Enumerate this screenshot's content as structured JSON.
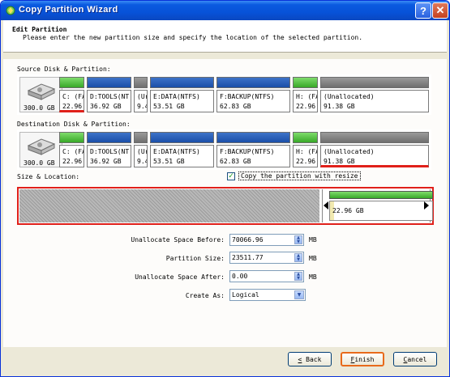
{
  "window": {
    "title": "Copy Partition Wizard",
    "help_label": "?",
    "close_label": "✕"
  },
  "header": {
    "title": "Edit Partition",
    "subtitle": "Please enter the new partition size and specify the location of the selected partition."
  },
  "source": {
    "label": "Source Disk & Partition:",
    "disk_size": "300.0 GB",
    "partitions": [
      {
        "line1": "C: (FA",
        "line2": "22.96",
        "color": "green"
      },
      {
        "line1": "D:TOOLS(NT",
        "line2": "36.92 GB",
        "color": "blue"
      },
      {
        "line1": "(Ur",
        "line2": "9.4",
        "color": "gray"
      },
      {
        "line1": "E:DATA(NTFS)",
        "line2": "53.51 GB",
        "color": "blue"
      },
      {
        "line1": "F:BACKUP(NTFS)",
        "line2": "62.83 GB",
        "color": "blue"
      },
      {
        "line1": "H: (FA",
        "line2": "22.96",
        "color": "green"
      },
      {
        "line1": "(Unallocated)",
        "line2": "91.38 GB",
        "color": "gray"
      }
    ]
  },
  "destination": {
    "label": "Destination Disk & Partition:",
    "disk_size": "300.0 GB",
    "partitions": [
      {
        "line1": "C: (FA",
        "line2": "22.96",
        "color": "green"
      },
      {
        "line1": "D:TOOLS(NT",
        "line2": "36.92 GB",
        "color": "blue"
      },
      {
        "line1": "(Ur",
        "line2": "9.4",
        "color": "gray"
      },
      {
        "line1": "E:DATA(NTFS)",
        "line2": "53.51 GB",
        "color": "blue"
      },
      {
        "line1": "F:BACKUP(NTFS)",
        "line2": "62.83 GB",
        "color": "blue"
      },
      {
        "line1": "H: (FA",
        "line2": "22.96",
        "color": "green"
      },
      {
        "line1": "(Unallocated)",
        "line2": "91.38 GB",
        "color": "gray"
      }
    ]
  },
  "size_location": {
    "label": "Size & Location:",
    "checkbox_label": "Copy the partition with resize",
    "checkbox_checked": true,
    "block_text": "22.96 GB"
  },
  "form": {
    "before_label": "Unallocate Space Before:",
    "before_value": "70066.96",
    "size_label": "Partition Size:",
    "size_value": "23511.77",
    "after_label": "Unallocate Space After:",
    "after_value": "0.00",
    "unit": "MB",
    "create_label": "Create As:",
    "create_value": "Logical"
  },
  "buttons": {
    "back": "< Back",
    "finish": "Finish",
    "cancel": "Cancel"
  },
  "colors": {
    "title_blue": "#0752d8",
    "green": "#38a828",
    "blue": "#1b4fa8",
    "gray": "#6f6f6f",
    "selected_red": "#e0201a",
    "finish_border": "#e86a1b"
  }
}
